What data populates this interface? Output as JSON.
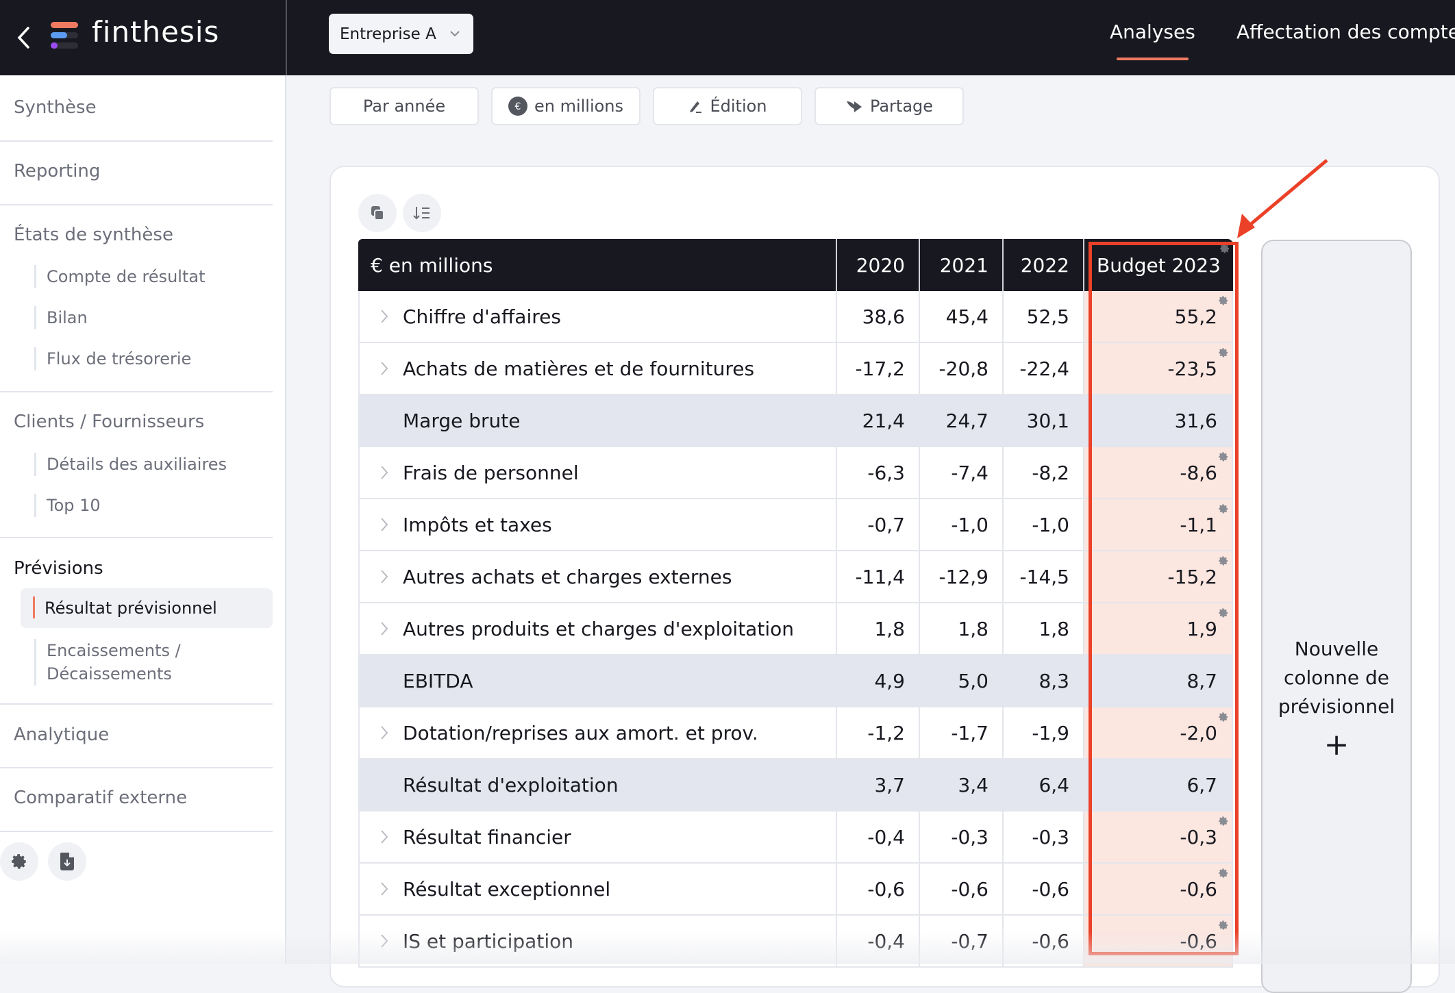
{
  "app": {
    "name": "finthesis",
    "company_selector": "Entreprise A",
    "nav_tabs": [
      {
        "label": "Analyses",
        "active": true
      },
      {
        "label": "Affectation des comptes",
        "active": false
      }
    ],
    "accent_color": "#ee7a62"
  },
  "sidebar": {
    "sections": [
      {
        "label": "Synthèse"
      },
      {
        "label": "Reporting"
      },
      {
        "label": "États de synthèse",
        "items": [
          "Compte de résultat",
          "Bilan",
          "Flux de trésorerie"
        ]
      },
      {
        "label": "Clients / Fournisseurs",
        "items": [
          "Détails des auxiliaires",
          "Top 10"
        ]
      },
      {
        "label": "Prévisions",
        "items": [
          "Résultat prévisionnel",
          "Encaissements / Décaissements"
        ],
        "active_item": "Résultat prévisionnel"
      },
      {
        "label": "Analytique"
      },
      {
        "label": "Comparatif externe"
      }
    ],
    "footer_icons": [
      "gear-icon",
      "file-download-icon"
    ]
  },
  "toolbar": {
    "buttons": [
      {
        "label": "Par année",
        "icon": null
      },
      {
        "label": "en millions",
        "icon": "euro-icon"
      },
      {
        "label": "Édition",
        "icon": "pencil-icon"
      },
      {
        "label": "Partage",
        "icon": "share-icon"
      }
    ],
    "table_actions": [
      "copy-icon",
      "sort-icon"
    ]
  },
  "table": {
    "unit_header": "€ en millions",
    "columns": [
      "2020",
      "2021",
      "2022",
      "Budget 2023"
    ],
    "rows": [
      {
        "label": "Chiffre d'affaires",
        "values": [
          "38,6",
          "45,4",
          "52,5",
          "55,2"
        ],
        "expandable": true,
        "subtotal": false
      },
      {
        "label": "Achats de matières et de fournitures",
        "values": [
          "-17,2",
          "-20,8",
          "-22,4",
          "-23,5"
        ],
        "expandable": true,
        "subtotal": false
      },
      {
        "label": "Marge brute",
        "values": [
          "21,4",
          "24,7",
          "30,1",
          "31,6"
        ],
        "expandable": false,
        "subtotal": true
      },
      {
        "label": "Frais de personnel",
        "values": [
          "-6,3",
          "-7,4",
          "-8,2",
          "-8,6"
        ],
        "expandable": true,
        "subtotal": false
      },
      {
        "label": "Impôts et taxes",
        "values": [
          "-0,7",
          "-1,0",
          "-1,0",
          "-1,1"
        ],
        "expandable": true,
        "subtotal": false
      },
      {
        "label": "Autres achats et charges externes",
        "values": [
          "-11,4",
          "-12,9",
          "-14,5",
          "-15,2"
        ],
        "expandable": true,
        "subtotal": false
      },
      {
        "label": "Autres produits et charges d'exploitation",
        "values": [
          "1,8",
          "1,8",
          "1,8",
          "1,9"
        ],
        "expandable": true,
        "subtotal": false
      },
      {
        "label": "EBITDA",
        "values": [
          "4,9",
          "5,0",
          "8,3",
          "8,7"
        ],
        "expandable": false,
        "subtotal": true
      },
      {
        "label": "Dotation/reprises aux amort. et prov.",
        "values": [
          "-1,2",
          "-1,7",
          "-1,9",
          "-2,0"
        ],
        "expandable": true,
        "subtotal": false
      },
      {
        "label": "Résultat d'exploitation",
        "values": [
          "3,7",
          "3,4",
          "6,4",
          "6,7"
        ],
        "expandable": false,
        "subtotal": true
      },
      {
        "label": "Résultat financier",
        "values": [
          "-0,4",
          "-0,3",
          "-0,3",
          "-0,3"
        ],
        "expandable": true,
        "subtotal": false
      },
      {
        "label": "Résultat exceptionnel",
        "values": [
          "-0,6",
          "-0,6",
          "-0,6",
          "-0,6"
        ],
        "expandable": true,
        "subtotal": false
      },
      {
        "label": "IS et participation",
        "values": [
          "-0,4",
          "-0,7",
          "-0,6",
          "-0,6"
        ],
        "expandable": true,
        "subtotal": false
      }
    ],
    "budget_cell_color": "#fbe6e0",
    "subtotal_row_color": "#e3e6ee"
  },
  "new_column_panel": {
    "label": "Nouvelle colonne de prévisionnel",
    "plus": "+"
  },
  "annotation": {
    "color": "#ea4128",
    "target": "Budget 2023"
  }
}
